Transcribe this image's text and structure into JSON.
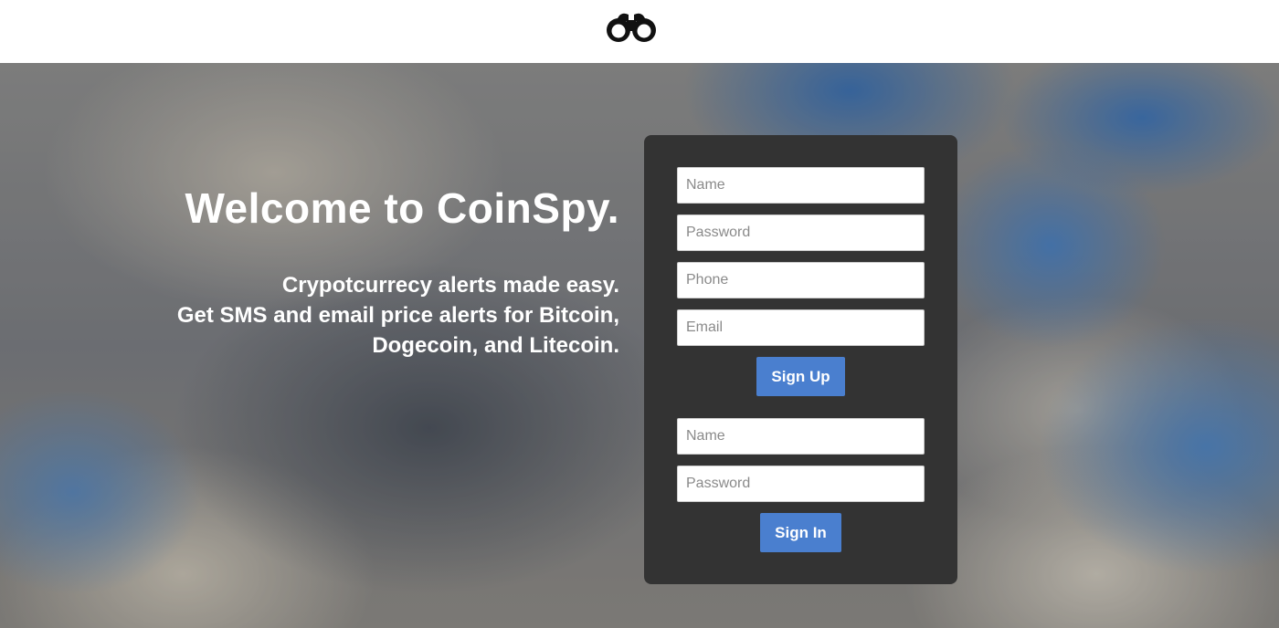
{
  "header": {
    "logo_icon": "binoculars-icon"
  },
  "hero": {
    "welcome": "Welcome to CoinSpy.",
    "tagline_lines": [
      "Crypotcurrecy alerts made easy.",
      "Get SMS and email price alerts for Bitcoin,",
      "Dogecoin, and Litecoin."
    ]
  },
  "signup": {
    "name_placeholder": "Name",
    "password_placeholder": "Password",
    "phone_placeholder": "Phone",
    "email_placeholder": "Email",
    "button_label": "Sign Up"
  },
  "signin": {
    "name_placeholder": "Name",
    "password_placeholder": "Password",
    "button_label": "Sign In"
  },
  "colors": {
    "panel_bg": "#333333",
    "button_bg": "#4a7fcf",
    "header_bg": "#ffffff"
  }
}
